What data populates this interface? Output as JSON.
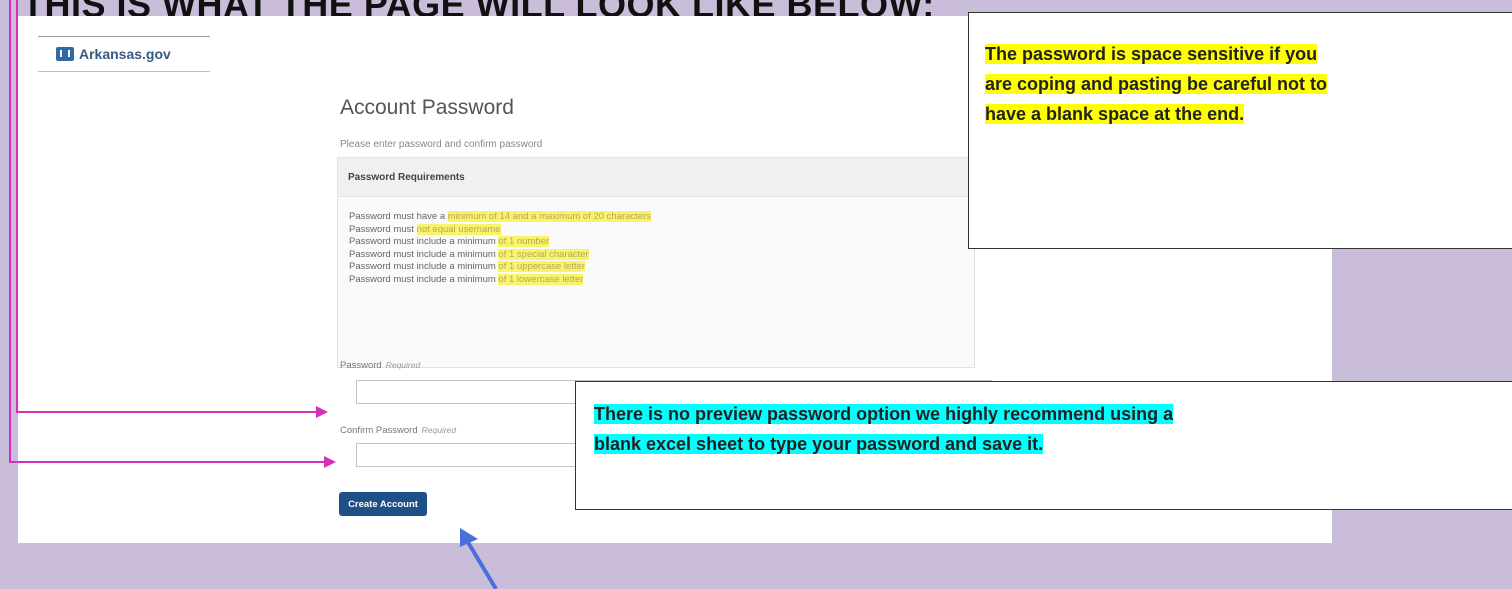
{
  "banner": {
    "title": "THIS IS WHAT THE PAGE WILL LOOK LIKE BELOW:"
  },
  "site": {
    "logo_text": "Arkansas.gov",
    "logo_icon": "arkansas-state-icon"
  },
  "form": {
    "title": "Account Password",
    "subtitle": "Please enter password and confirm password",
    "requirements": {
      "heading": "Password Requirements",
      "items": [
        {
          "prefix": "Password must have a ",
          "highlight": "minimum of 14 and a maximum of 20 characters"
        },
        {
          "prefix": "Password must ",
          "highlight": "not equal username"
        },
        {
          "prefix": "Password must include a minimum ",
          "highlight": "of 1 number"
        },
        {
          "prefix": "Password must include a minimum ",
          "highlight": "of 1 special character"
        },
        {
          "prefix": "Password must include a minimum ",
          "highlight": "of 1 uppercase letter"
        },
        {
          "prefix": "Password must include a minimum ",
          "highlight": "of 1 lowercase letter"
        }
      ]
    },
    "password_label": "Password",
    "password_required": "Required",
    "password_value": "",
    "confirm_label": "Confirm Password",
    "confirm_required": "Required",
    "confirm_value": "",
    "create_button": "Create Account"
  },
  "notes": {
    "space_note": [
      "The password is space sensitive if you",
      "are coping and pasting be careful not to",
      "have a blank space at the end."
    ],
    "preview_note": [
      "There is no preview password option we highly recommend using a",
      "blank  excel sheet to type your password and save it."
    ]
  },
  "colors": {
    "background": "#c9bdd9",
    "button": "#1e4f86",
    "arrow_magenta": "#d630b8",
    "arrow_blue": "#4a6fd8",
    "note_highlight_yellow": "#ffff00",
    "note_highlight_cyan": "#00ffff"
  }
}
